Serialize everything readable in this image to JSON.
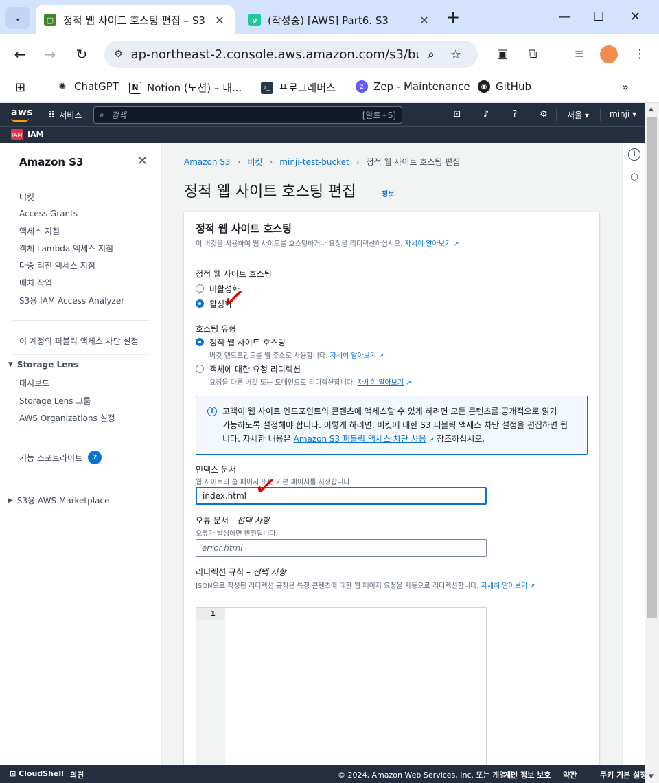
{
  "browser": {
    "tabs": [
      {
        "title": "정적 웹 사이트 호스팅 편집 – S3",
        "favicon": "s3-icon",
        "active": true
      },
      {
        "title": "(작성중) [AWS] Part6. S3",
        "favicon": "velog-icon",
        "active": false
      }
    ],
    "url": "ap-northeast-2.console.aws.amazon.com/s3/buck...",
    "bookmarks": [
      "ChatGPT",
      "Notion (노션) – 내...",
      "프로그래머스",
      "Zep - Maintenance",
      "GitHub"
    ]
  },
  "aws_nav": {
    "logo": "aws",
    "services": "서비스",
    "search_placeholder": "검색",
    "search_shortcut": "[알트+S]",
    "region": "서울 ▾",
    "user": "minji ▾",
    "favorite": "IAM"
  },
  "sidebar": {
    "title": "Amazon S3",
    "items": [
      "버킷",
      "Access Grants",
      "액세스 지점",
      "객체 Lambda 액세스 지점",
      "다중 리전 액세스 지점",
      "배치 작업",
      "S3용 IAM Access Analyzer"
    ],
    "account_block": "이 계정의 퍼블릭 액세스 차단 설정",
    "storage_lens": {
      "label": "Storage Lens",
      "items": [
        "대시보드",
        "Storage Lens 그룹",
        "AWS Organizations 설정"
      ]
    },
    "feature_spotlight": "기능 스포트라이트",
    "feature_badge": "7",
    "marketplace": "S3용 AWS Marketplace"
  },
  "breadcrumb": [
    "Amazon S3",
    "버킷",
    "minji-test-bucket",
    "정적 웹 사이트 호스팅 편집"
  ],
  "page": {
    "title": "정적 웹 사이트 호스팅 편집",
    "info": "정보"
  },
  "panel": {
    "title": "정적 웹 사이트 호스팅",
    "desc": "이 버킷을 사용하여 웹 사이트를 호스팅하거나 요청을 리디렉션하십시오.",
    "learn_more": "자세히 알아보기",
    "hosting_label": "정적 웹 사이트 호스팅",
    "hosting_options": [
      "비활성화",
      "활성화"
    ],
    "hosting_type_label": "호스팅 유형",
    "type_static": "정적 웹 사이트 호스팅",
    "type_static_desc": "버킷 엔드포인트를 웹 주소로 사용합니다.",
    "type_redirect": "객체에 대한 요청 리디렉션",
    "type_redirect_desc": "요청을 다른 버킷 또는 도메인으로 리디렉션합니다.",
    "alert_line1": "고객이 웹 사이트 엔드포인트의 콘텐츠에 액세스할 수 있게 하려면 모든 콘텐츠를 공개적으로 읽기",
    "alert_line2": "가능하도록 설정해야 합니다. 이렇게 하려면, 버킷에 대한 S3 퍼블릭 액세스 차단 설정을 편집하면 됩",
    "alert_line3_pre": "니다. 자세한 내용은 ",
    "alert_link": "Amazon S3 퍼블릭 액세스 차단 사용",
    "alert_line3_post": " 참조하십시오.",
    "index_label": "인덱스 문서",
    "index_desc": "웹 사이트의 홈 페이지 또는 기본 페이지를 지정합니다.",
    "index_value": "index.html",
    "error_label": "오류 문서 - ",
    "error_optional": "선택 사항",
    "error_desc": "오류가 발생하면 반환됩니다.",
    "error_placeholder": "error.html",
    "redirect_label": "리디렉션 규칙 – ",
    "redirect_optional": "선택 사항",
    "redirect_desc": "JSON으로 작성된 리디렉션 규칙은 특정 콘텐츠에 대한 웹 페이지 요청을 자동으로 리디렉션합니다.",
    "editor_line": "1"
  },
  "annotation_mark": "✓",
  "footer": {
    "cloudshell": "CloudShell",
    "feedback": "의견",
    "copyright": "© 2024, Amazon Web Services, Inc. 또는 계열사.",
    "privacy": "개인 정보 보호",
    "terms": "약관",
    "cookies": "쿠키 기본 설정"
  },
  "colors": {
    "aws_nav": "#232f3e",
    "link": "#0972d3",
    "annotation": "#e00000"
  }
}
